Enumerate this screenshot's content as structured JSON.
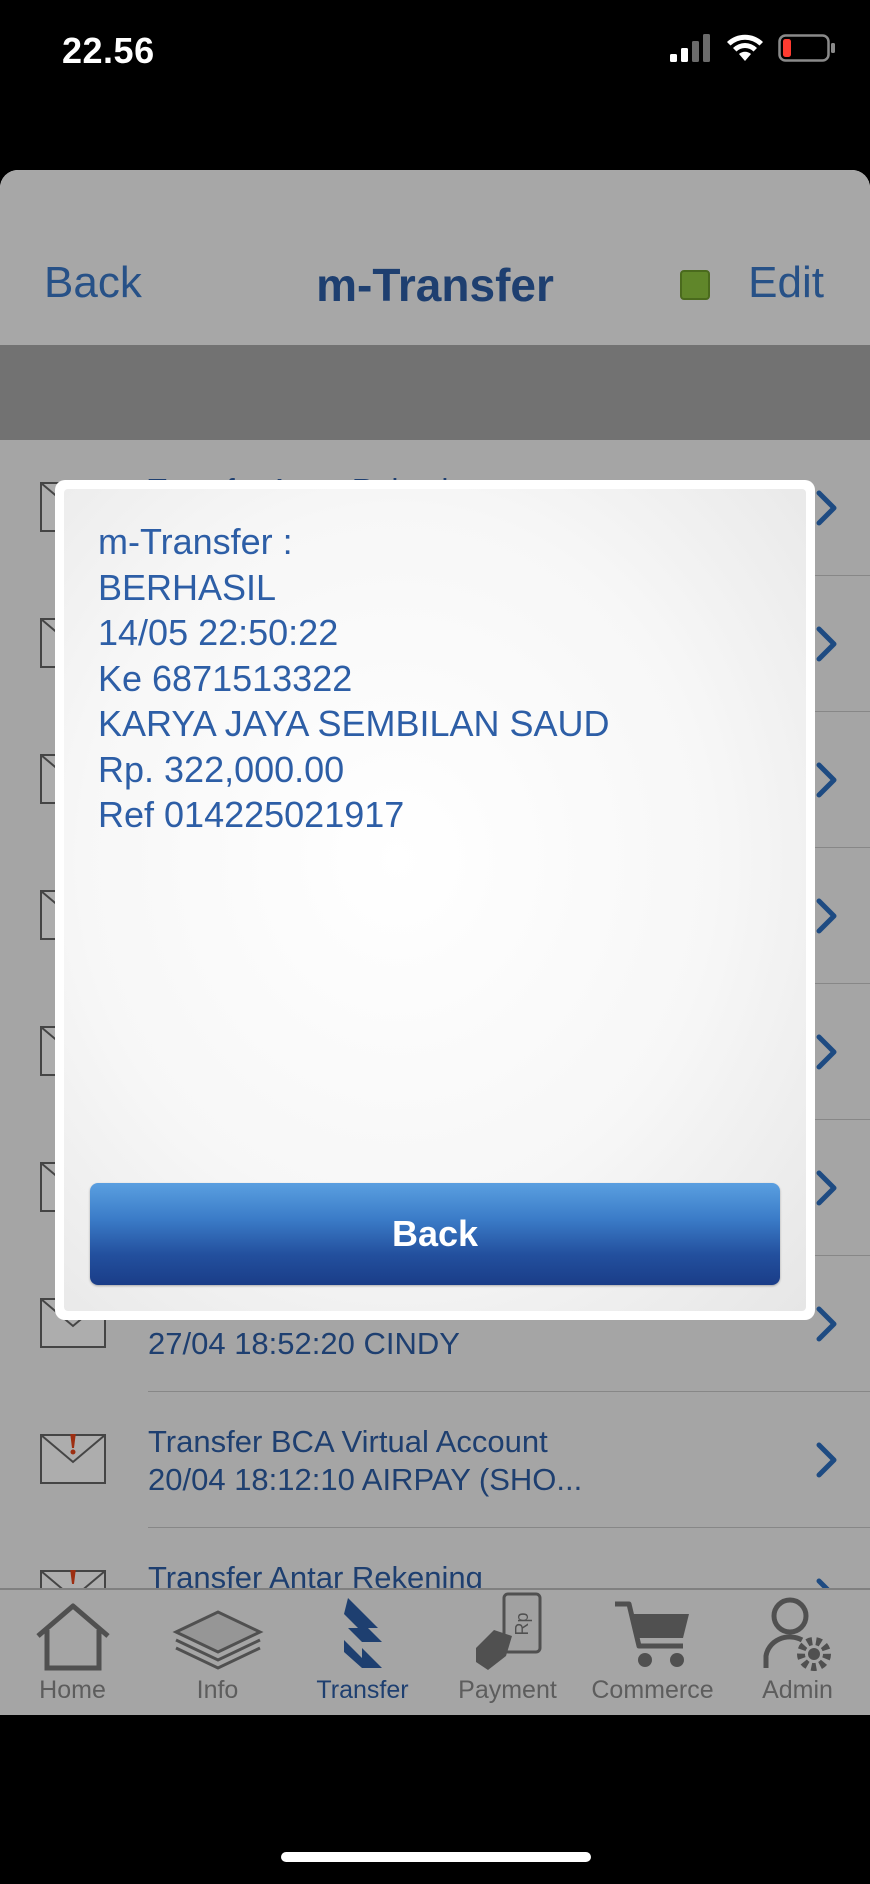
{
  "status": {
    "time": "22.56"
  },
  "nav": {
    "back": "Back",
    "title": "m-Transfer",
    "edit": "Edit"
  },
  "list": [
    {
      "line1": "Transfer Antar Rekening",
      "line2": "",
      "icon": "envelope-yellow"
    },
    {
      "line1": "",
      "line2": "",
      "icon": "envelope-yellow"
    },
    {
      "line1": "",
      "line2": "",
      "icon": "envelope-yellow"
    },
    {
      "line1": "",
      "line2": "",
      "icon": "envelope"
    },
    {
      "line1": "",
      "line2": "",
      "icon": "envelope"
    },
    {
      "line1": "",
      "line2": "",
      "icon": "envelope"
    },
    {
      "line1": "",
      "line2": "27/04 18:52:20 CINDY",
      "icon": "envelope-red"
    },
    {
      "line1": "Transfer BCA Virtual Account",
      "line2": "20/04 18:12:10 AIRPAY (SHO...",
      "icon": "envelope-red"
    },
    {
      "line1": "Transfer Antar Rekening",
      "line2": "",
      "icon": "envelope-red"
    }
  ],
  "tabs": {
    "home": "Home",
    "info": "Info",
    "transfer": "Transfer",
    "payment": "Payment",
    "commerce": "Commerce",
    "admin": "Admin"
  },
  "dialog": {
    "lines": [
      "m-Transfer :",
      "BERHASIL",
      "14/05 22:50:22",
      "Ke 6871513322",
      "KARYA JAYA SEMBILAN SAUD",
      "Rp. 322,000.00",
      "Ref 014225021917"
    ],
    "button": "Back"
  },
  "colors": {
    "accent": "#2d5ea6",
    "link": "#3a78c8",
    "indicator": "#8ec63f",
    "button_top": "#5a9fe0",
    "button_bottom": "#1a3d88"
  }
}
